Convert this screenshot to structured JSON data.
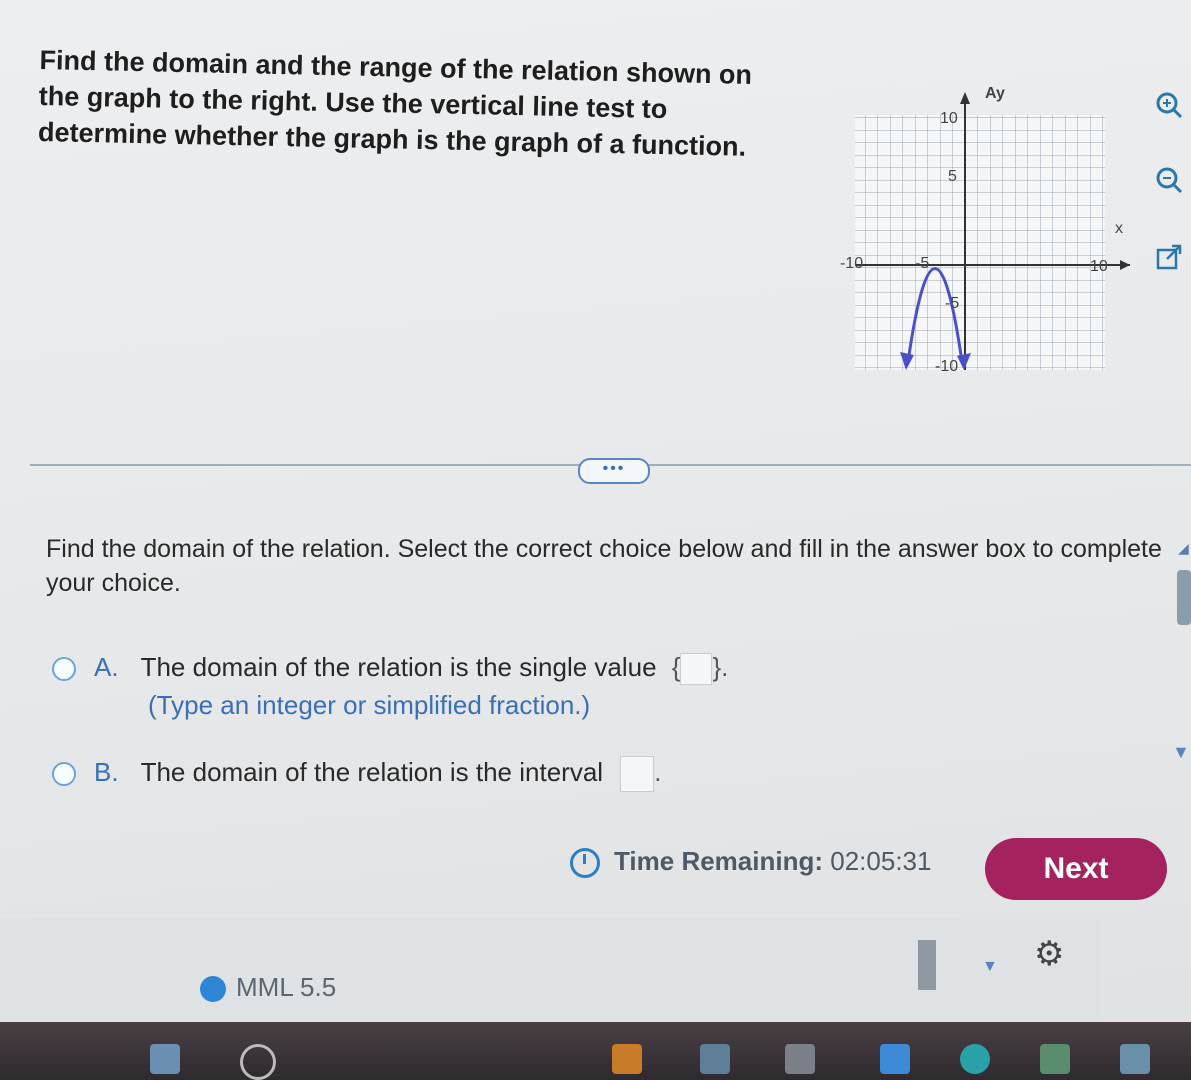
{
  "question": {
    "text": "Find the domain and the range of the relation shown on the graph to the right. Use the vertical line test to determine whether the graph is the graph of a function."
  },
  "graph": {
    "y_axis_label": "Ay",
    "x_axis_label": "x",
    "ticks": {
      "y_top": "10",
      "y_mid": "5",
      "y_neg_mid": "-5",
      "y_bottom": "-10",
      "x_left": "-10",
      "x_mid_left": "-5",
      "x_right": "10"
    },
    "curve_color": "#4b50c8"
  },
  "side_tools": {
    "zoom_in": "zoom-in-icon",
    "zoom_out": "zoom-out-icon",
    "popout": "external-link-icon"
  },
  "more_button": {
    "label": "•••"
  },
  "sub_question": {
    "text": "Find the domain of the relation. Select the correct choice below and fill in the answer box to complete your choice."
  },
  "choices": {
    "a": {
      "letter": "A.",
      "text": "The domain of the relation is the single value",
      "open_brace": "{",
      "close_brace": "}.",
      "hint": "(Type an integer or simplified fraction.)"
    },
    "b": {
      "letter": "B.",
      "text": "The domain of the relation is the interval",
      "end": "."
    }
  },
  "timer": {
    "label": "Time Remaining:",
    "value": "02:05:31"
  },
  "next_button": {
    "label": "Next"
  },
  "footer": {
    "mml_label": "MML 5.5"
  },
  "colors": {
    "next_bg": "#a4235e",
    "accent_blue": "#2f86d4"
  }
}
